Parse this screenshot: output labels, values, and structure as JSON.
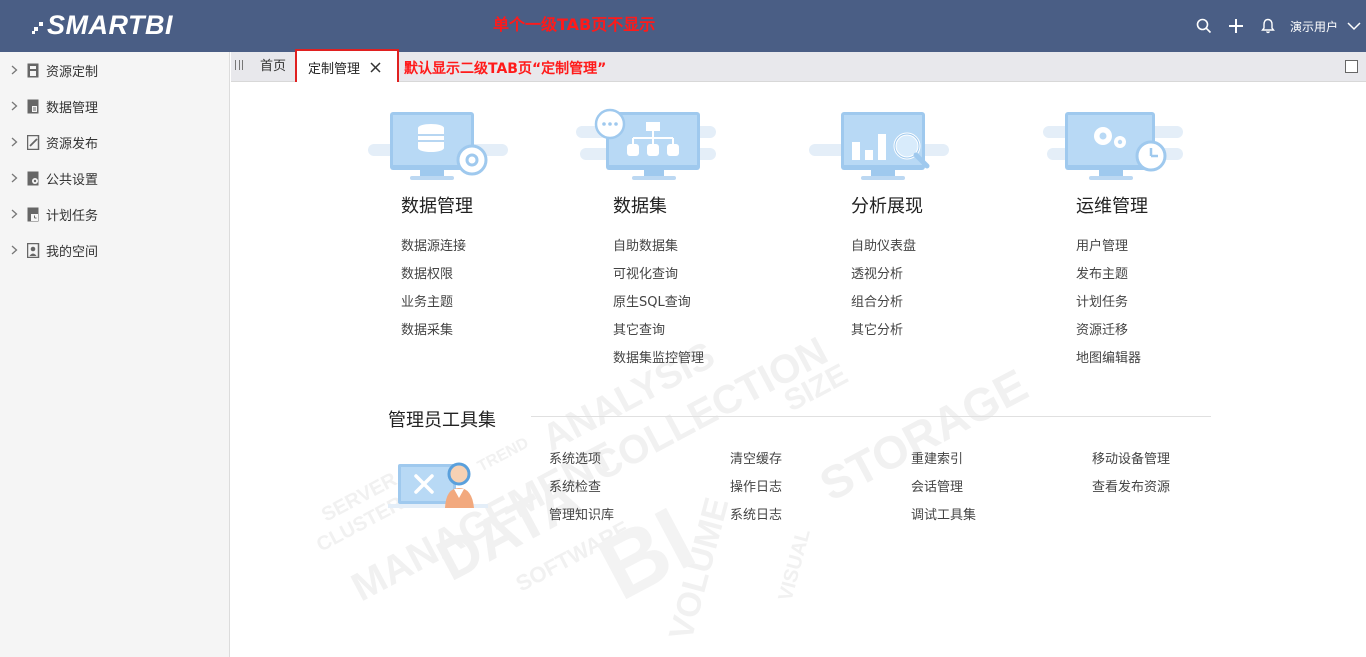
{
  "app": {
    "logo_text": "SMARTBI",
    "annotation_top": "单个一级TAB页不显示"
  },
  "topbar": {
    "user_name": "演示用户",
    "icons": [
      "search-icon",
      "plus-icon",
      "bell-icon",
      "chevron-down-icon"
    ]
  },
  "sidebar": {
    "items": [
      {
        "label": "资源定制",
        "icon": "resource-custom-icon"
      },
      {
        "label": "数据管理",
        "icon": "data-manage-icon"
      },
      {
        "label": "资源发布",
        "icon": "resource-publish-icon"
      },
      {
        "label": "公共设置",
        "icon": "public-settings-icon"
      },
      {
        "label": "计划任务",
        "icon": "scheduled-task-icon"
      },
      {
        "label": "我的空间",
        "icon": "my-space-icon"
      }
    ]
  },
  "tabs": {
    "home_label": "首页",
    "active_label": "定制管理",
    "annotation": "默认显示二级TAB页“定制管理”"
  },
  "main": {
    "columns": [
      {
        "title": "数据管理",
        "links": [
          "数据源连接",
          "数据权限",
          "业务主题",
          "数据采集"
        ]
      },
      {
        "title": "数据集",
        "links": [
          "自助数据集",
          "可视化查询",
          "原生SQL查询",
          "其它查询",
          "数据集监控管理"
        ]
      },
      {
        "title": "分析展现",
        "links": [
          "自助仪表盘",
          "透视分析",
          "组合分析",
          "其它分析"
        ]
      },
      {
        "title": "运维管理",
        "links": [
          "用户管理",
          "发布主题",
          "计划任务",
          "资源迁移",
          "地图编辑器"
        ]
      }
    ],
    "tools": {
      "title": "管理员工具集",
      "columns": [
        [
          "系统选项",
          "系统检查",
          "管理知识库"
        ],
        [
          "清空缓存",
          "操作日志",
          "系统日志"
        ],
        [
          "重建索引",
          "会话管理",
          "调试工具集"
        ],
        [
          "移动设备管理",
          "查看发布资源"
        ]
      ]
    },
    "wordcloud": [
      "DATA",
      "MANAGEMENT",
      "STORAGE",
      "ANALYSIS",
      "COLLECTION",
      "SIZE",
      "VOLUME",
      "SOFTWARE",
      "CLUSTER",
      "SERVER",
      "TREND",
      "VISUAL"
    ]
  }
}
